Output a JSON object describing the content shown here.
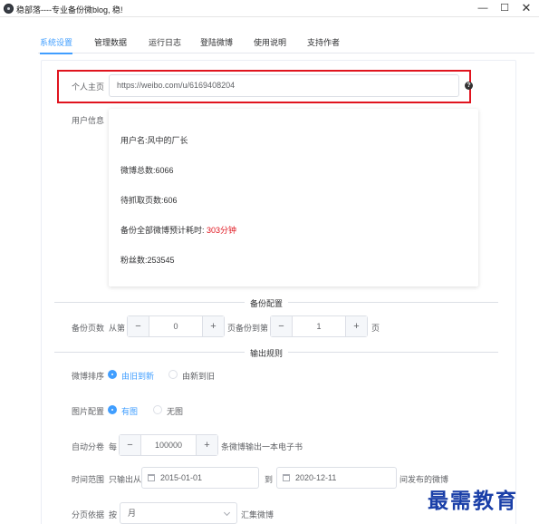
{
  "window": {
    "title": "稳部落----专业备份微blog, 稳!",
    "minimize": "—",
    "maximize": "☐",
    "close": "✕"
  },
  "tabs": [
    {
      "label": "系统设置",
      "active": true
    },
    {
      "label": "管理数据",
      "active": false
    },
    {
      "label": "运行日志",
      "active": false
    },
    {
      "label": "登陆微博",
      "active": false
    },
    {
      "label": "使用说明",
      "active": false
    },
    {
      "label": "支持作者",
      "active": false
    }
  ],
  "homepage": {
    "label": "个人主页",
    "value": "https://weibo.com/u/6169408204",
    "help_icon": "?"
  },
  "user_info": {
    "label": "用户信息",
    "username": "用户名:风中的厂长",
    "weibo_count": "微博总数:6066",
    "pending_pages": "待抓取页数:606",
    "estimate_label": "备份全部微博预计耗时:",
    "estimate_value": "303分钟",
    "followers": "粉丝数:253545"
  },
  "backup_config": {
    "section_title": "备份配置",
    "pages_label": "备份页数",
    "from_label": "从第",
    "from_value": "0",
    "middle_label": "页备份到第",
    "to_value": "1",
    "end_label": "页"
  },
  "output_rules": {
    "section_title": "输出规则",
    "order_label": "微博排序",
    "order_option_1": "由旧到新",
    "order_option_2": "由新到旧",
    "image_label": "图片配置",
    "image_option_1": "有图",
    "image_option_2": "无图",
    "split_label": "自动分卷",
    "split_prefix": "每",
    "split_value": "100000",
    "split_suffix": "条微博输出一本电子书",
    "time_label": "时间范围",
    "time_prefix": "只输出从",
    "time_from": "2015-01-01",
    "time_to_label": "到",
    "time_to": "2020-12-11",
    "time_suffix": "间发布的微博",
    "page_label": "分页依据",
    "page_prefix": "按",
    "page_value": "月",
    "page_suffix": "汇集微博"
  },
  "stepper_symbols": {
    "minus": "−",
    "plus": "+"
  },
  "watermark": "最需教育",
  "colors": {
    "accent": "#409eff",
    "highlight": "#e0141e",
    "watermark": "#1a3fa8"
  }
}
